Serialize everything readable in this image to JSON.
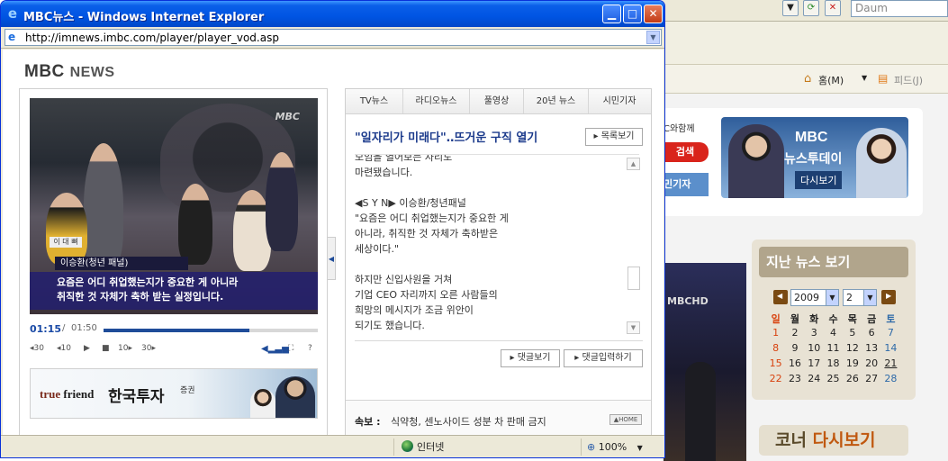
{
  "background_window": {
    "search_placeholder": "Daum",
    "home_label": "홈(M)",
    "feed_label": "피드(J)",
    "mbc_with": "C와함께",
    "search_button": "검색",
    "reporter_label": "민기자",
    "news_banner": {
      "brand": "MBC",
      "title": "뉴스투데이",
      "cta": "다시보기"
    },
    "video_watermark": "MBCHD",
    "past_news_title": "지난 뉴스 보기",
    "calendar": {
      "year": "2009",
      "month": "2",
      "weekdays": [
        "일",
        "월",
        "화",
        "수",
        "목",
        "금",
        "토"
      ],
      "weeks": [
        [
          "1",
          "2",
          "3",
          "4",
          "5",
          "6",
          "7"
        ],
        [
          "8",
          "9",
          "10",
          "11",
          "12",
          "13",
          "14"
        ],
        [
          "15",
          "16",
          "17",
          "18",
          "19",
          "20",
          "21"
        ],
        [
          "22",
          "23",
          "24",
          "25",
          "26",
          "27",
          "28"
        ]
      ]
    },
    "corner_title_a": "코너",
    "corner_title_b": "다시보기"
  },
  "window": {
    "title": "MBC뉴스 - Windows Internet Explorer",
    "url": "http://imnews.imbc.com/player/player_vod.asp"
  },
  "logo": {
    "mbc": "MBC",
    "news": "NEWS"
  },
  "video": {
    "watermark": "MBC",
    "name_card": "이 대 뼈",
    "speaker_label": "이승환(청년 패널)",
    "subtitle_line1": "요즘은 어디 취업했는지가 중요한 게 아니라",
    "subtitle_line2": "취직한 것 자체가 축하 받는 실정입니다.",
    "current_time": "01:15",
    "separator": "/",
    "total_time": "01:50",
    "progress_fraction": 0.68
  },
  "controls": {
    "rewind30": "◂30",
    "rewind10": "◂10",
    "play": "▶",
    "stop": "■",
    "forward10": "10▸",
    "forward30": "30▸",
    "fullscreen": "⛶",
    "help": "?"
  },
  "ad": {
    "brand_a": "true",
    "brand_b": "friend",
    "name": "한국투자",
    "suffix": "증권"
  },
  "tabs": [
    "TV뉴스",
    "라디오뉴스",
    "풀영상",
    "20년 뉴스",
    "시민기자"
  ],
  "article": {
    "headline": "\"일자리가 미래다\"‥뜨거운 구직 열기",
    "list_button": "▸ 목록보기",
    "body": "모임을 열어보는 자리도\n마련됐습니다.\n\n◀S Y N▶ 이승환/청년패널\n\"요즘은 어디 취업했는지가 중요한 게\n아니라, 취직한 것 자체가 축하받은\n세상이다.\"\n\n하지만 신입사원을 거쳐\n기업 CEO 자리까지 오른 사람들의\n희망의 메시지가 조금 위안이\n되기도 했습니다.",
    "view_comments": "▸ 댓글보기",
    "write_comment": "▸ 댓글입력하기"
  },
  "ticker": {
    "label": "속보 :",
    "text": "식약청, 센노사이드 성분 차 판매 금지",
    "home": "▲HOME"
  },
  "status": {
    "zone": "인터넷",
    "zoom": "100%"
  }
}
